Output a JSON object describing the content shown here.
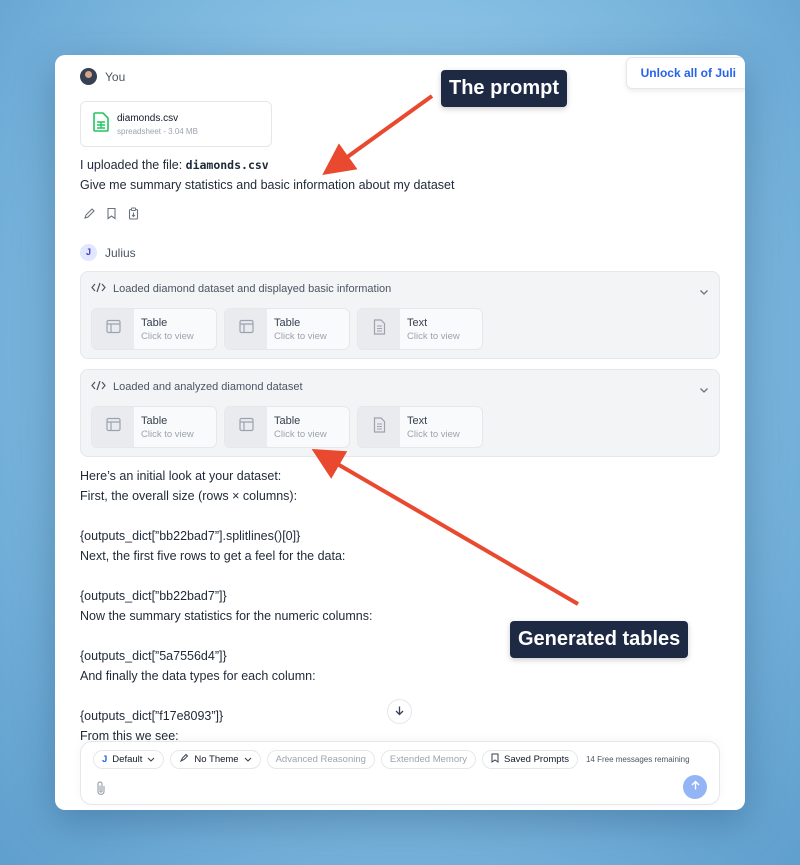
{
  "banner": {
    "unlock_label": "Unlock all of Juli"
  },
  "user_message": {
    "author": "You",
    "file": {
      "name": "diamonds.csv",
      "meta": "spreadsheet - 3.04 MB"
    },
    "line1_prefix": "I uploaded the file: ",
    "line1_code": "diamonds.csv",
    "line2": "Give me summary statistics and basic information about my dataset",
    "action_icons": [
      "pencil-icon",
      "bookmark-icon",
      "clipboard-icon"
    ]
  },
  "assistant": {
    "author": "Julius",
    "avatar_letter": "J",
    "panels": [
      {
        "title": "Loaded diamond dataset and displayed basic information",
        "chips": [
          {
            "title": "Table",
            "sub": "Click to view",
            "icon": "table-icon"
          },
          {
            "title": "Table",
            "sub": "Click to view",
            "icon": "table-icon"
          },
          {
            "title": "Text",
            "sub": "Click to view",
            "icon": "document-icon"
          }
        ]
      },
      {
        "title": "Loaded and analyzed diamond dataset",
        "chips": [
          {
            "title": "Table",
            "sub": "Click to view",
            "icon": "table-icon"
          },
          {
            "title": "Table",
            "sub": "Click to view",
            "icon": "table-icon"
          },
          {
            "title": "Text",
            "sub": "Click to view",
            "icon": "document-icon"
          }
        ]
      }
    ],
    "lines": [
      "Here’s an initial look at your dataset:",
      "First, the overall size (rows × columns):",
      "{outputs_dict[”bb22bad7”].splitlines()[0]}",
      "Next, the first five rows to get a feel for the data:",
      "{outputs_dict[”bb22bad7”]}",
      "Now the summary statistics for the numeric columns:",
      "{outputs_dict[”5a7556d4”]}",
      "And finally the data types for each column:",
      "{outputs_dict[”f17e8093”]}",
      "From this we see:"
    ]
  },
  "composer": {
    "model": "Default",
    "model_letter": "J",
    "theme": "No Theme",
    "advanced_reasoning": "Advanced Reasoning",
    "extended_memory": "Extended Memory",
    "saved_prompts": "Saved Prompts",
    "free_messages": "14 Free messages remaining"
  },
  "callouts": {
    "prompt": "The prompt",
    "tables": "Generated tables"
  },
  "colors": {
    "accent": "#2563eb",
    "callout_bg": "#1e2a44",
    "arrow": "#e8492f",
    "file_icon": "#22c55e"
  }
}
